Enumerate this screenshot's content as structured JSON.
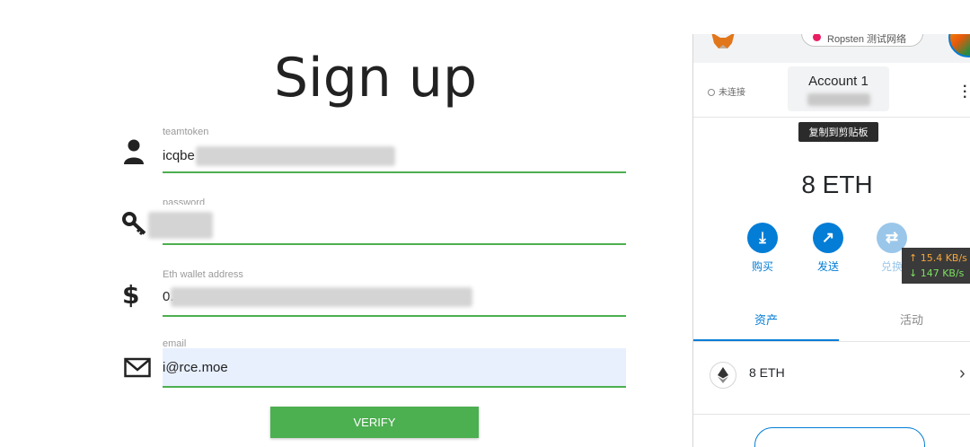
{
  "signup": {
    "title": "Sign up",
    "fields": {
      "teamtoken": {
        "label": "teamtoken",
        "value": "icqbe"
      },
      "password": {
        "label": "password",
        "value": ""
      },
      "wallet": {
        "label": "Eth wallet address",
        "value": "0."
      },
      "email": {
        "label": "email",
        "value": "i@rce.moe"
      }
    },
    "verify_label": "VERIFY",
    "accent": "#4caf50"
  },
  "wallet": {
    "network": "Ropsten 测试网络",
    "connection_status": "未连接",
    "account_name": "Account 1",
    "copy_tooltip": "复制到剪贴板",
    "balance": "8 ETH",
    "actions": {
      "buy": "购买",
      "send": "发送",
      "swap": "兑换"
    },
    "speed": {
      "up": "↑ 15.4 KB/s",
      "down": "↓ 147 KB/s"
    },
    "tabs": {
      "assets": "资产",
      "activity": "活动"
    },
    "asset": {
      "amount": "8 ETH"
    },
    "accent": "#037dd6"
  }
}
